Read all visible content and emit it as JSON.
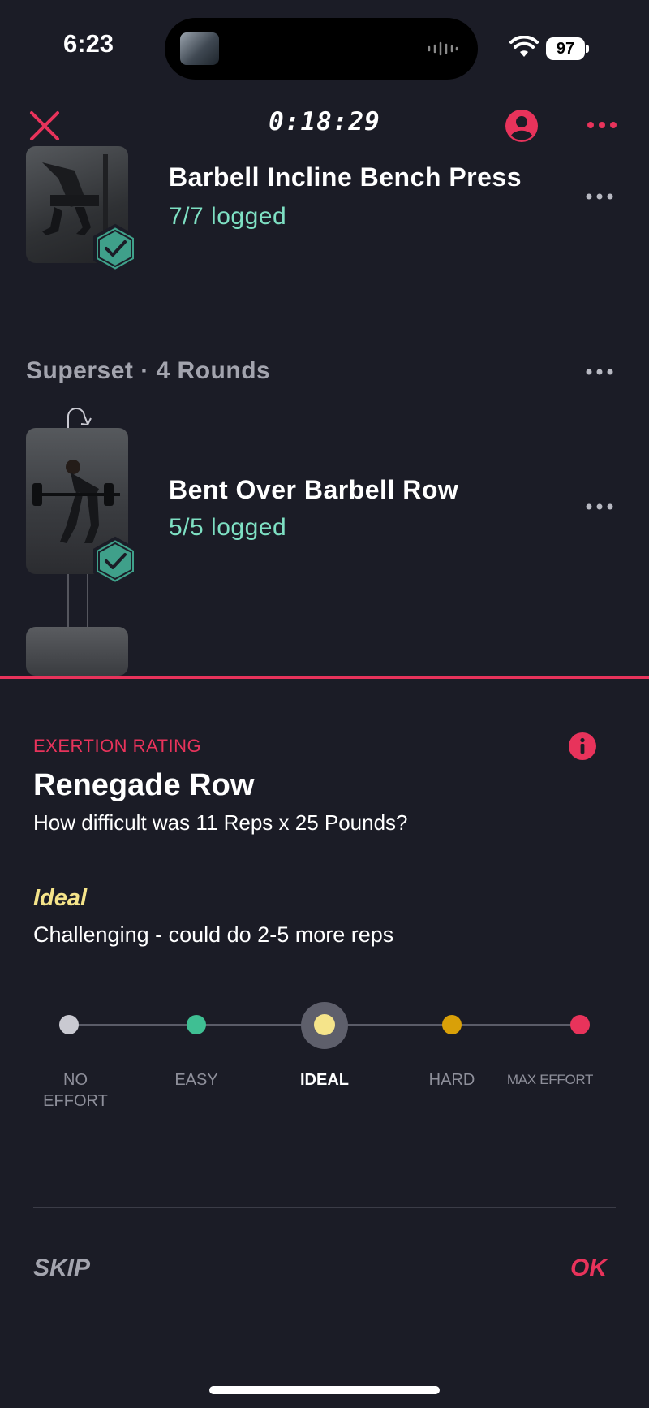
{
  "status_bar": {
    "time": "6:23",
    "battery": "97"
  },
  "nav": {
    "timer": "0:18:29"
  },
  "exercises": [
    {
      "name": "Barbell Incline Bench Press",
      "logged": "7/7 logged"
    },
    {
      "name": "Bent Over Barbell Row",
      "logged": "5/5 logged"
    }
  ],
  "superset": {
    "label": "Superset · 4 Rounds"
  },
  "sheet": {
    "section_label": "EXERTION RATING",
    "exercise_name": "Renegade Row",
    "question": "How difficult was 11 Reps x 25 Pounds?",
    "selected_level": "Ideal",
    "selected_description": "Challenging - could do 2-5 more reps",
    "scale": [
      {
        "label_line1": "NO",
        "label_line2": "EFFORT",
        "color": "#c9c9d1"
      },
      {
        "label_line1": "EASY",
        "label_line2": "",
        "color": "#3fbf93"
      },
      {
        "label_line1": "IDEAL",
        "label_line2": "",
        "color": "#f5e48a"
      },
      {
        "label_line1": "HARD",
        "label_line2": "",
        "color": "#d9a008"
      },
      {
        "label_line1": "MAX EFFORT",
        "label_line2": "",
        "color": "#e8335b"
      }
    ],
    "selected_index": 2,
    "skip_label": "SKIP",
    "ok_label": "OK"
  },
  "colors": {
    "accent": "#e8335b",
    "logged": "#7ee0c3",
    "background": "#1b1c26"
  },
  "icons": [
    "close-icon",
    "profile-icon",
    "more-icon",
    "check-badge-icon",
    "loop-arrow-icon",
    "info-icon",
    "wifi-icon"
  ]
}
